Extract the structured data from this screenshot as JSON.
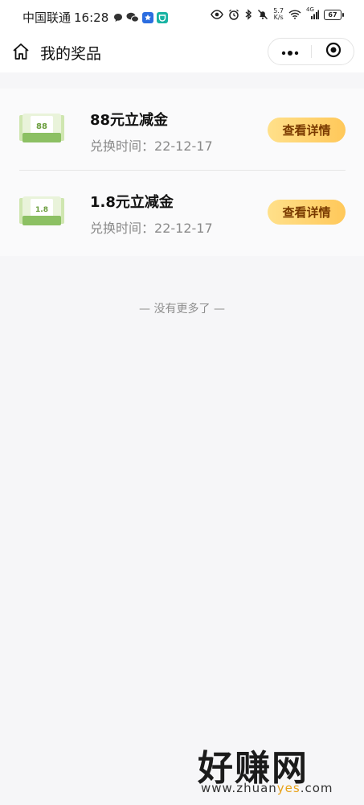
{
  "status_bar": {
    "carrier": "中国联通",
    "time": "16:28",
    "speed_value": "5.7",
    "speed_unit": "K/s",
    "network": "4G",
    "battery": "67"
  },
  "nav": {
    "title": "我的奖品"
  },
  "prizes": [
    {
      "thumb_label": "88",
      "name": "88元立减金",
      "date_label": "兑换时间：",
      "date": "22-12-17",
      "button_label": "查看详情"
    },
    {
      "thumb_label": "1.8",
      "name": "1.8元立减金",
      "date_label": "兑换时间：",
      "date": "22-12-17",
      "button_label": "查看详情"
    }
  ],
  "end_text": "— 没有更多了 —",
  "watermark": {
    "brand": "好赚网",
    "url_prefix": "www.zhuan",
    "url_accent": "yes",
    "url_suffix": ".com"
  },
  "colors": {
    "button_gradient_start": "#ffe08a",
    "button_gradient_end": "#ffc85a",
    "button_text": "#7a3a00",
    "thumb_green": "#8cc063",
    "watermark_accent": "#e8a21a"
  }
}
